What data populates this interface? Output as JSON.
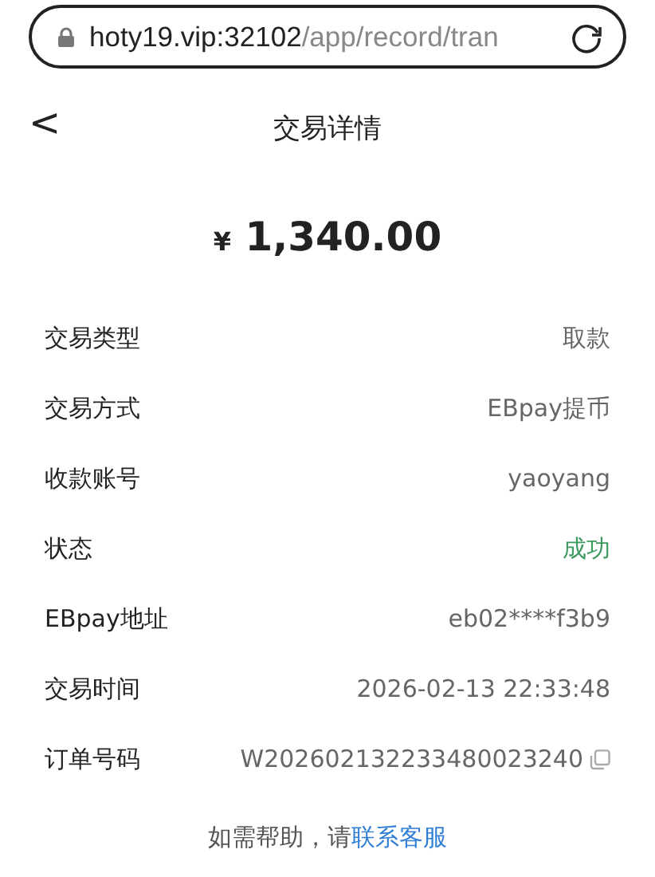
{
  "address_bar": {
    "host": "hoty19.vip:32102",
    "path": "/app/record/tran"
  },
  "header": {
    "back": "<",
    "title": "交易详情"
  },
  "amount": {
    "currency": "¥",
    "value": "1,340.00"
  },
  "details": [
    {
      "label": "交易类型",
      "value": "取款",
      "kind": "text"
    },
    {
      "label": "交易方式",
      "value": "EBpay提币",
      "kind": "text"
    },
    {
      "label": "收款账号",
      "value": "yaoyang",
      "kind": "text"
    },
    {
      "label": "状态",
      "value": "成功",
      "kind": "status"
    },
    {
      "label": "EBpay地址",
      "value": "eb02****f3b9",
      "kind": "text"
    },
    {
      "label": "交易时间",
      "value": "2026-02-13 22:33:48",
      "kind": "text"
    },
    {
      "label": "订单号码",
      "value": "W202602132233480023240",
      "kind": "copy"
    }
  ],
  "help": {
    "text": "如需帮助，请",
    "link": "联系客服"
  }
}
